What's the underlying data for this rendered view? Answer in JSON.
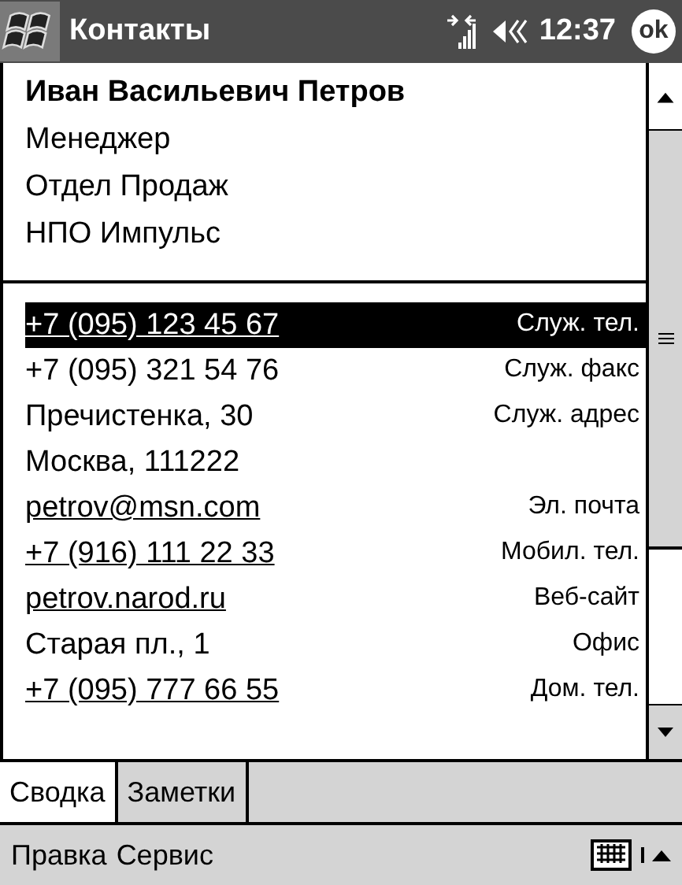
{
  "title_bar": {
    "title": "Контакты",
    "time": "12:37",
    "ok": "ok"
  },
  "contact": {
    "name": "Иван Васильевич Петров",
    "details": [
      "Менеджер",
      "Отдел Продаж",
      "НПО Импульс"
    ]
  },
  "fields": [
    {
      "lines": [
        "+7 (095) 123 45 67"
      ],
      "label": "Служ. тел.",
      "link": true,
      "selected": true
    },
    {
      "lines": [
        "+7 (095) 321 54 76"
      ],
      "label": "Служ. факс",
      "link": false,
      "selected": false
    },
    {
      "lines": [
        "Пречистенка, 30",
        "Москва, 111222"
      ],
      "label": "Служ. адрес",
      "link": false,
      "selected": false
    },
    {
      "lines": [
        "petrov@msn.com"
      ],
      "label": "Эл. почта",
      "link": true,
      "selected": false
    },
    {
      "lines": [
        "+7 (916) 111 22 33"
      ],
      "label": "Мобил. тел.",
      "link": true,
      "selected": false
    },
    {
      "lines": [
        "petrov.narod.ru"
      ],
      "label": "Веб-сайт",
      "link": true,
      "selected": false
    },
    {
      "lines": [
        "Старая пл., 1"
      ],
      "label": "Офис",
      "link": false,
      "selected": false
    },
    {
      "lines": [
        "+7 (095) 777 66 55"
      ],
      "label": "Дом. тел.",
      "link": true,
      "selected": false
    }
  ],
  "tabs": [
    {
      "label": "Сводка",
      "selected": true
    },
    {
      "label": "Заметки",
      "selected": false
    }
  ],
  "menu": [
    "Правка",
    "Сервис"
  ]
}
